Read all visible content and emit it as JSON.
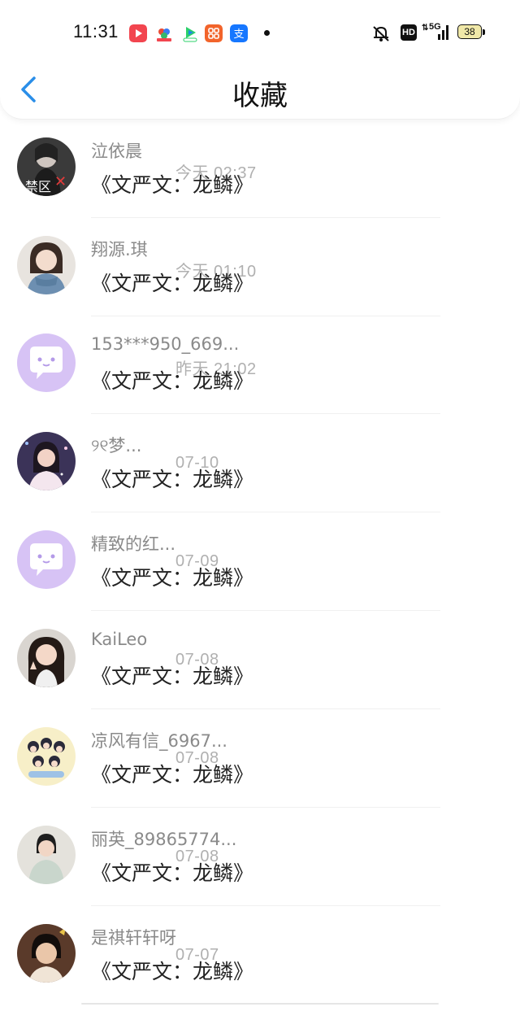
{
  "status_bar": {
    "time": "11:31",
    "network": "5G",
    "hd_badge": "HD",
    "battery": "38",
    "app_icons": [
      {
        "name": "video-app-icon",
        "color": "#f2454f"
      },
      {
        "name": "cloud-app-icon",
        "color": "#ffffff"
      },
      {
        "name": "iqiyi-app-icon",
        "color": "#ffffff"
      },
      {
        "name": "grid-app-icon",
        "color": "#f2642b"
      },
      {
        "name": "alipay-app-icon",
        "color": "#1677ff"
      }
    ]
  },
  "header": {
    "title": "收藏",
    "back_icon": "chevron-left-icon",
    "accent": "#2a8ee8"
  },
  "favorites": [
    {
      "name": "泣依晨",
      "time": "今天 02:37",
      "message": "《文严文：龙鳞》",
      "avatar_label": "禁区",
      "avatar_style": "dark-photo"
    },
    {
      "name": "翔源.琪",
      "time": "今天 01:10",
      "message": "《文严文：龙鳞》",
      "avatar_style": "photo-scarf"
    },
    {
      "name": "153***950_669...",
      "time": "昨天 21:02",
      "message": "《文严文：龙鳞》",
      "avatar_style": "default-purple"
    },
    {
      "name": "୨୧梦...",
      "time": "07-10",
      "message": "《文严文：龙鳞》",
      "avatar_style": "photo-night"
    },
    {
      "name": "精致的红...",
      "time": "07-09",
      "message": "《文严文：龙鳞》",
      "avatar_style": "default-purple"
    },
    {
      "name": "KaiLeo",
      "time": "07-08",
      "message": "《文严文：龙鳞》",
      "avatar_style": "photo-portrait"
    },
    {
      "name": "凉风有信_6967...",
      "time": "07-08",
      "message": "《文严文：龙鳞》",
      "avatar_style": "cartoon-group"
    },
    {
      "name": "丽英_89865774...",
      "time": "07-08",
      "message": "《文严文：龙鳞》",
      "avatar_style": "photo-grey"
    },
    {
      "name": "是祺轩轩呀",
      "time": "07-07",
      "message": "《文严文：龙鳞》",
      "avatar_style": "photo-dark"
    }
  ]
}
